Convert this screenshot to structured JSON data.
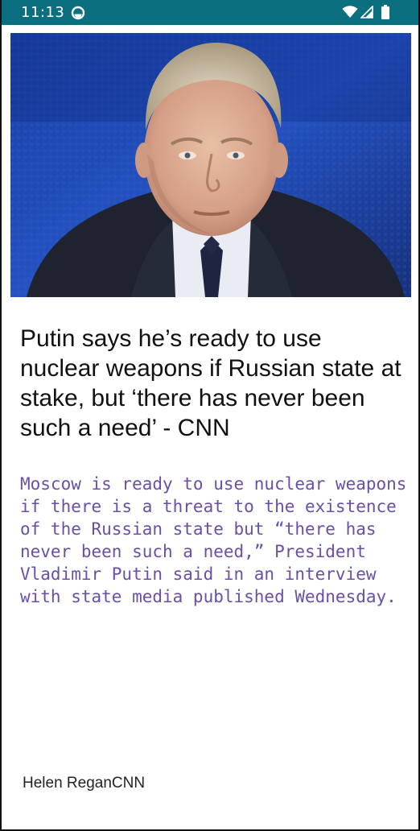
{
  "status_bar": {
    "time": "11:13",
    "icons": [
      "sync-icon",
      "wifi-icon",
      "signal-icon",
      "battery-icon"
    ],
    "background": "#0b6f7f"
  },
  "article": {
    "image": "portrait-photo",
    "headline": "Putin says he’s ready to use nuclear weapons if Russian state at stake, but ‘there has never been such a need’ - CNN",
    "summary": "Moscow is ready to use nuclear weapons if there is a threat to the existence of the Russian state but “there has never been such a need,” President Vladimir Putin said in an interview with state media published Wednesday.",
    "author": "Helen Regan",
    "source": "CNN"
  },
  "colors": {
    "summary_text": "#6b4fa6",
    "headline_text": "#111111"
  }
}
